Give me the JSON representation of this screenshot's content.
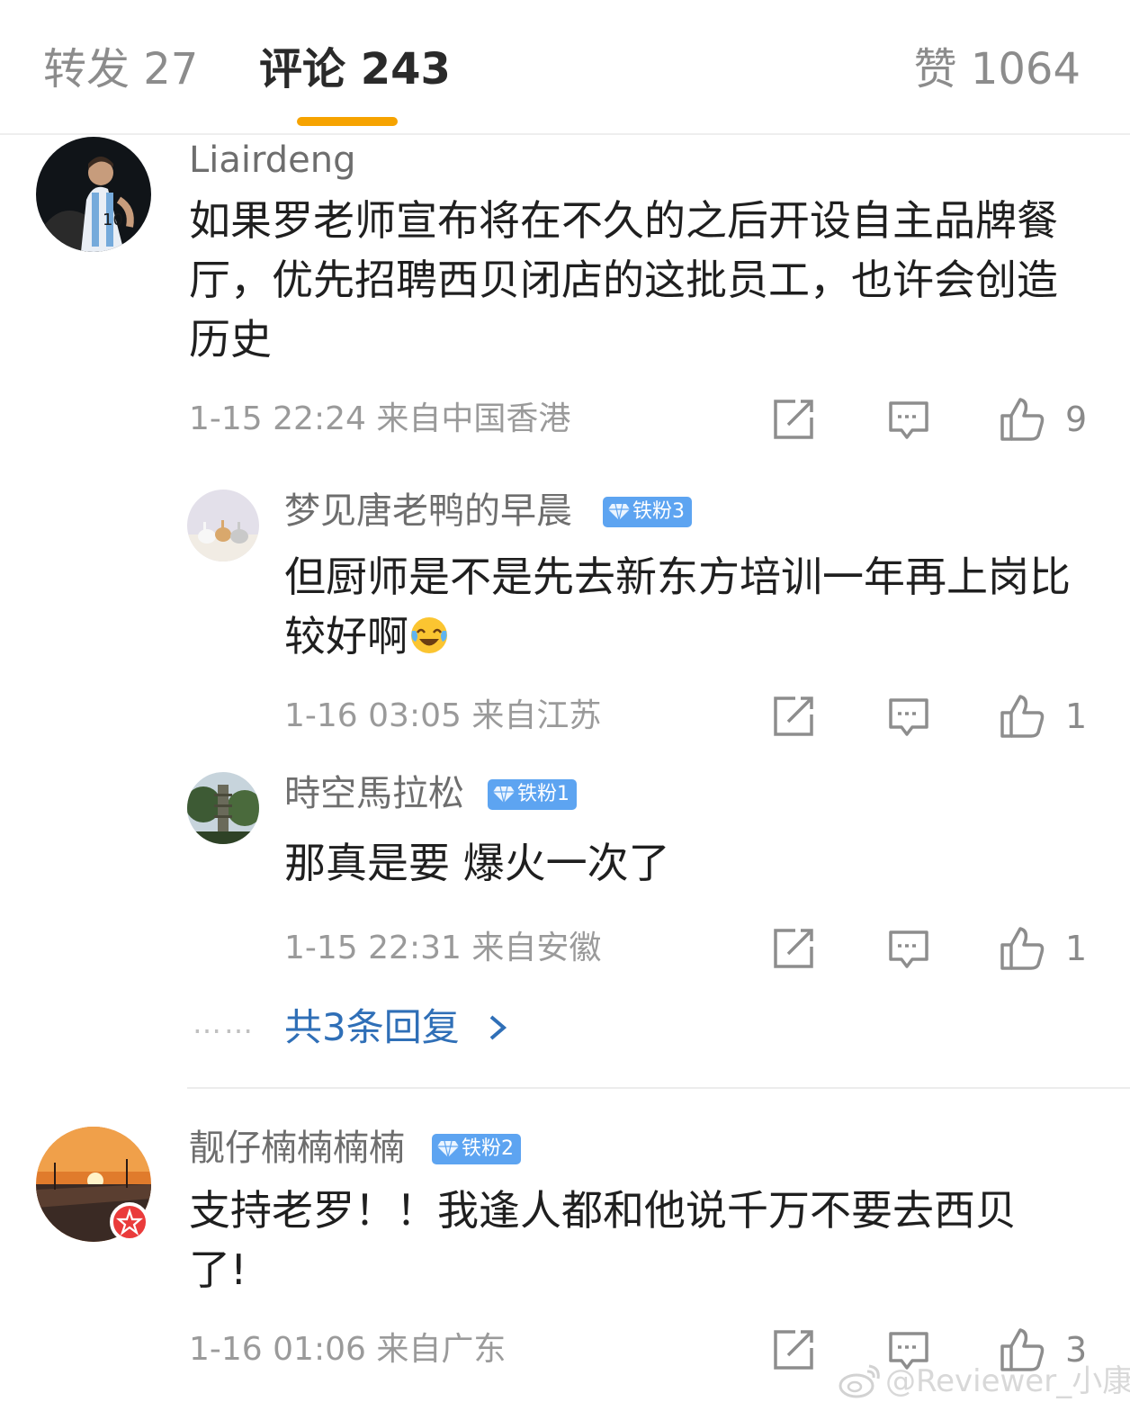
{
  "tabs": {
    "repost": "转发 27",
    "comments": "评论 243",
    "likes": "赞 1064",
    "active_color": "#f6a300"
  },
  "comments": [
    {
      "username": "Liairdeng",
      "text": "如果罗老师宣布将在不久的之后开设自主品牌餐厅，优先招聘西贝闭店的这批员工，也许会创造历史",
      "time": "1-15 22:24",
      "location": "来自中国香港",
      "like_count": "9",
      "avatar": "soccer-player-avatar"
    },
    {
      "username": "靓仔楠楠楠楠",
      "badge": "铁粉2",
      "text": "支持老罗！！我逢人都和他说千万不要去西贝了!",
      "time": "1-16 01:06",
      "location": "来自广东",
      "like_count": "3",
      "avatar": "sunset-avatar"
    }
  ],
  "replies": [
    {
      "username": "梦见唐老鸭的早晨",
      "badge": "铁粉3",
      "text": "但厨师是不是先去新东方培训一年再上岗比较好啊",
      "time": "1-16 03:05",
      "location": "来自江苏",
      "like_count": "1",
      "emoji": "laughing-crying-emoji"
    },
    {
      "username": "時空馬拉松",
      "badge": "铁粉1",
      "text": "那真是要 爆火一次了",
      "time": "1-15 22:31",
      "location": "来自安徽",
      "like_count": "1"
    }
  ],
  "more_replies": {
    "dots": "……",
    "label": "共3条回复"
  },
  "watermark": "@Reviewer_小康",
  "colors": {
    "badge": "#5da4f1",
    "link": "#2f6fb7",
    "meta": "#9a9a9a"
  }
}
